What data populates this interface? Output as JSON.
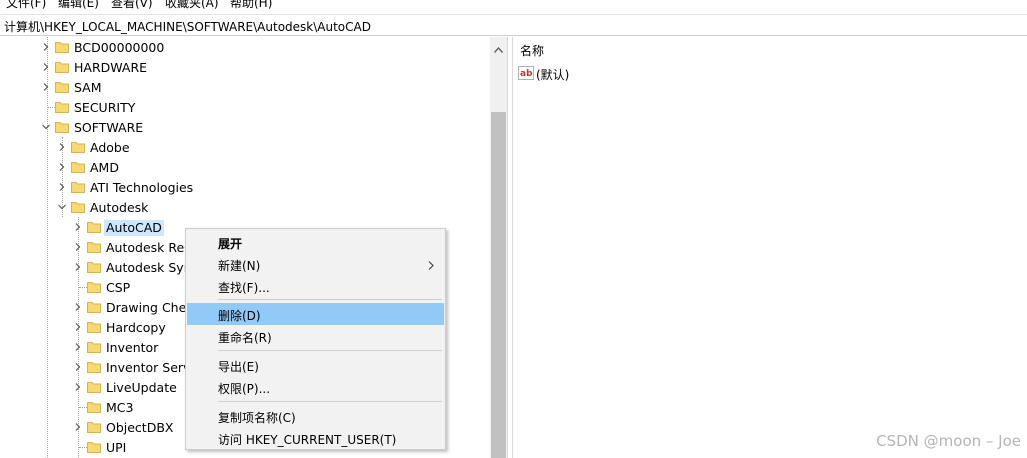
{
  "menubar": {
    "items": [
      "文件(F)",
      "编辑(E)",
      "查看(V)",
      "收藏夹(A)",
      "帮助(H)"
    ]
  },
  "address": {
    "path": "计算机\\HKEY_LOCAL_MACHINE\\SOFTWARE\\Autodesk\\AutoCAD"
  },
  "tree": {
    "items": [
      {
        "label": "BCD00000000",
        "level": 0,
        "expander": "collapsed"
      },
      {
        "label": "HARDWARE",
        "level": 0,
        "expander": "collapsed"
      },
      {
        "label": "SAM",
        "level": 0,
        "expander": "collapsed"
      },
      {
        "label": "SECURITY",
        "level": 0,
        "expander": "none"
      },
      {
        "label": "SOFTWARE",
        "level": 0,
        "expander": "expanded"
      },
      {
        "label": "Adobe",
        "level": 1,
        "expander": "collapsed"
      },
      {
        "label": "AMD",
        "level": 1,
        "expander": "collapsed"
      },
      {
        "label": "ATI Technologies",
        "level": 1,
        "expander": "collapsed"
      },
      {
        "label": "Autodesk",
        "level": 1,
        "expander": "expanded"
      },
      {
        "label": "AutoCAD",
        "level": 2,
        "expander": "collapsed",
        "selected": true
      },
      {
        "label": "Autodesk ReCap",
        "level": 2,
        "expander": "collapsed"
      },
      {
        "label": "Autodesk Sync",
        "level": 2,
        "expander": "collapsed"
      },
      {
        "label": "CSP",
        "level": 2,
        "expander": "none"
      },
      {
        "label": "Drawing Check",
        "level": 2,
        "expander": "collapsed"
      },
      {
        "label": "Hardcopy",
        "level": 2,
        "expander": "collapsed"
      },
      {
        "label": "Inventor",
        "level": 2,
        "expander": "collapsed"
      },
      {
        "label": "Inventor Server",
        "level": 2,
        "expander": "collapsed"
      },
      {
        "label": "LiveUpdate",
        "level": 2,
        "expander": "collapsed"
      },
      {
        "label": "MC3",
        "level": 2,
        "expander": "none"
      },
      {
        "label": "ObjectDBX",
        "level": 2,
        "expander": "collapsed"
      },
      {
        "label": "UPI",
        "level": 2,
        "expander": "none"
      }
    ]
  },
  "values_pane": {
    "column_name": "名称",
    "rows": [
      {
        "icon": "string-value-icon",
        "name": "(默认)"
      }
    ]
  },
  "context_menu": {
    "items": [
      {
        "label": "展开",
        "bold": true
      },
      {
        "label": "新建(N)",
        "submenu": true
      },
      {
        "label": "查找(F)..."
      },
      {
        "label": "删除(D)",
        "highlighted": true
      },
      {
        "label": "重命名(R)"
      },
      {
        "label": "导出(E)"
      },
      {
        "label": "权限(P)..."
      },
      {
        "label": "复制项名称(C)"
      },
      {
        "label": "访问 HKEY_CURRENT_USER(T)"
      }
    ]
  },
  "watermark": "CSDN @moon – Joe",
  "colors": {
    "selection": "#cce8ff",
    "menu_highlight": "#91c9f7",
    "folder": "#f8d775"
  }
}
